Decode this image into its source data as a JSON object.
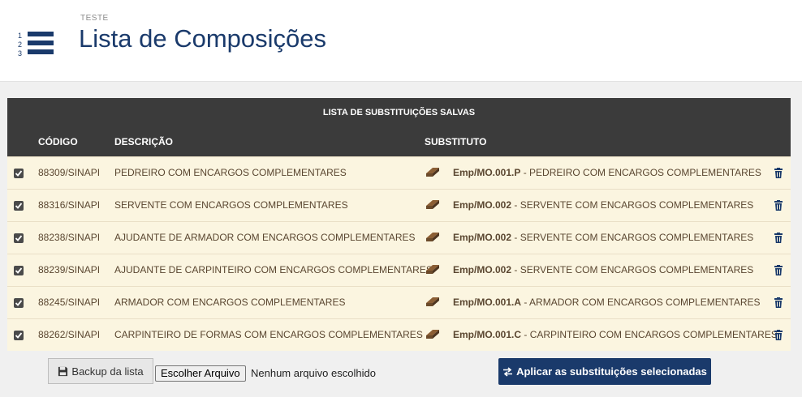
{
  "header": {
    "subtitle": "TESTE",
    "title": "Lista de Composições",
    "logo_numbers": [
      "1",
      "2",
      "3"
    ]
  },
  "table": {
    "banner": "LISTA DE SUBSTITUIÇÕES SALVAS",
    "columns": {
      "code": "CÓDIGO",
      "description": "DESCRIÇÃO",
      "substitute": "SUBSTITUTO"
    },
    "rows": [
      {
        "checked": true,
        "code": "88309/SINAPI",
        "description": "PEDREIRO COM ENCARGOS COMPLEMENTARES",
        "sub_code": "Emp/MO.001.P",
        "sub_desc": " - PEDREIRO COM ENCARGOS COMPLEMENTARES"
      },
      {
        "checked": true,
        "code": "88316/SINAPI",
        "description": "SERVENTE COM ENCARGOS COMPLEMENTARES",
        "sub_code": "Emp/MO.002",
        "sub_desc": " - SERVENTE COM ENCARGOS COMPLEMENTARES"
      },
      {
        "checked": true,
        "code": "88238/SINAPI",
        "description": "AJUDANTE DE ARMADOR COM ENCARGOS COMPLEMENTARES",
        "sub_code": "Emp/MO.002",
        "sub_desc": " - SERVENTE COM ENCARGOS COMPLEMENTARES"
      },
      {
        "checked": true,
        "code": "88239/SINAPI",
        "description": "AJUDANTE DE CARPINTEIRO COM ENCARGOS COMPLEMENTARES",
        "sub_code": "Emp/MO.002",
        "sub_desc": " - SERVENTE COM ENCARGOS COMPLEMENTARES"
      },
      {
        "checked": true,
        "code": "88245/SINAPI",
        "description": "ARMADOR COM ENCARGOS COMPLEMENTARES",
        "sub_code": "Emp/MO.001.A",
        "sub_desc": " - ARMADOR COM ENCARGOS COMPLEMENTARES"
      },
      {
        "checked": true,
        "code": "88262/SINAPI",
        "description": "CARPINTEIRO DE FORMAS COM ENCARGOS COMPLEMENTARES",
        "sub_code": "Emp/MO.001.C",
        "sub_desc": " - CARPINTEIRO COM ENCARGOS COMPLEMENTARES"
      }
    ]
  },
  "footer": {
    "backup_label": "Backup da lista",
    "file_button_label": "Escolher Arquivo",
    "file_status": "Nenhum arquivo escolhido",
    "apply_label": "Aplicar as substituições selecionadas"
  },
  "colors": {
    "brand": "#1a3a6b",
    "table_header": "#3b3b3b",
    "row_bg": "#fbf5e0",
    "row_text": "#5a4630",
    "icon_brown": "#6b4a2a"
  }
}
